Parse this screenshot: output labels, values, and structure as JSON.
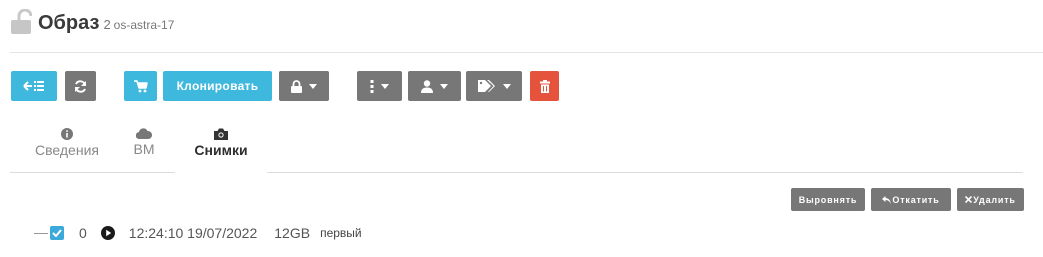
{
  "header": {
    "title": "Образ",
    "id": "2",
    "name": "os-astra-17",
    "icon": "unlocked-lock-icon"
  },
  "toolbar": {
    "clone_label": "Клонировать",
    "colors": {
      "blue": "#3fb8de",
      "gray": "#777777",
      "red": "#e5533d"
    }
  },
  "tabs": [
    {
      "label": "Сведения",
      "icon": "info-icon"
    },
    {
      "label": "ВМ",
      "icon": "cloud-icon"
    },
    {
      "label": "Снимки",
      "icon": "camera-icon",
      "active": true
    }
  ],
  "actions": {
    "revert_label": "Выровнять",
    "rollback_label": "Откатить",
    "delete_label": "Удалить"
  },
  "snapshots": [
    {
      "checked": true,
      "index": "0",
      "timestamp": "12:24:10 19/07/2022",
      "size": "12GB",
      "name": "первый"
    }
  ]
}
